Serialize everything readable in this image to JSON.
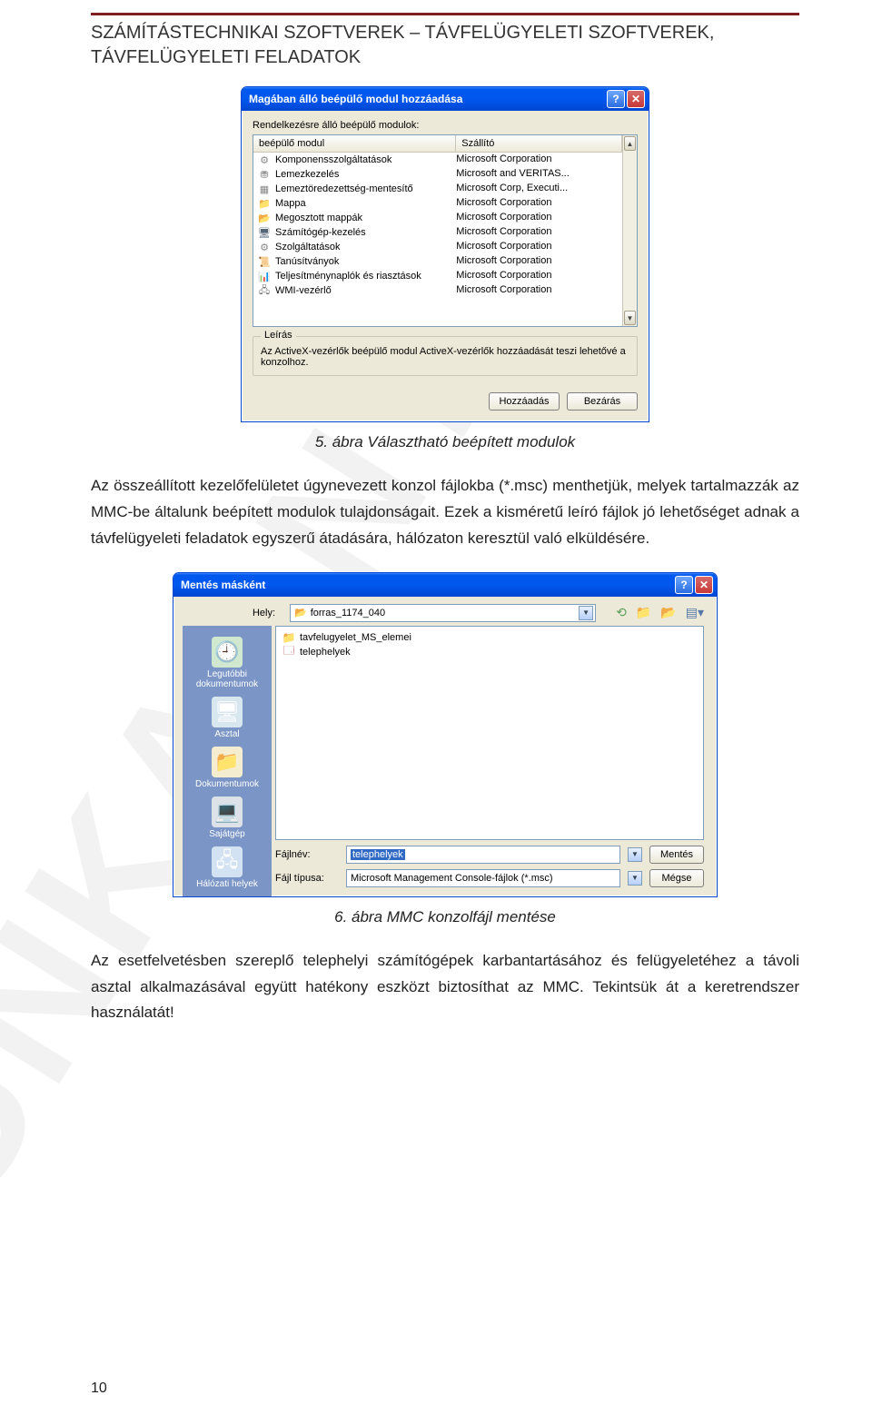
{
  "header": {
    "title": "SZÁMÍTÁSTECHNIKAI SZOFTVEREK – TÁVFELÜGYELETI SZOFTVEREK, TÁVFELÜGYELETI FELADATOK"
  },
  "watermark": "MUNKAANYAG",
  "dialog1": {
    "title": "Magában álló beépülő modul hozzáadása",
    "available_label": "Rendelkezésre álló beépülő modulok:",
    "col_module": "beépülő modul",
    "col_vendor": "Szállító",
    "rows": [
      {
        "name": "Komponensszolgáltatások",
        "vendor": "Microsoft Corporation"
      },
      {
        "name": "Lemezkezelés",
        "vendor": "Microsoft and VERITAS..."
      },
      {
        "name": "Lemeztöredezettség-mentesítő",
        "vendor": "Microsoft Corp, Executi..."
      },
      {
        "name": "Mappa",
        "vendor": "Microsoft Corporation"
      },
      {
        "name": "Megosztott mappák",
        "vendor": "Microsoft Corporation"
      },
      {
        "name": "Számítógép-kezelés",
        "vendor": "Microsoft Corporation"
      },
      {
        "name": "Szolgáltatások",
        "vendor": "Microsoft Corporation"
      },
      {
        "name": "Tanúsítványok",
        "vendor": "Microsoft Corporation"
      },
      {
        "name": "Teljesítménynaplók és riasztások",
        "vendor": "Microsoft Corporation"
      },
      {
        "name": "WMI-vezérlő",
        "vendor": "Microsoft Corporation"
      }
    ],
    "desc_legend": "Leírás",
    "desc_text": "Az ActiveX-vezérlők beépülő modul ActiveX-vezérlők hozzáadását teszi lehetővé a konzolhoz.",
    "btn_add": "Hozzáadás",
    "btn_close": "Bezárás"
  },
  "caption1": "5. ábra Választható beépített modulok",
  "para1": "Az összeállított kezelőfelületet úgynevezett konzol fájlokba (*.msc) menthetjük, melyek tartalmazzák az MMC-be általunk beépített modulok tulajdonságait. Ezek a kisméretű leíró fájlok jó lehetőséget adnak a távfelügyeleti feladatok egyszerű átadására, hálózaton keresztül való elküldésére.",
  "dialog2": {
    "title": "Mentés másként",
    "loc_label": "Hely:",
    "loc_value": "forras_1174_040",
    "places": [
      {
        "name": "Legutóbbi dokumentumok"
      },
      {
        "name": "Asztal"
      },
      {
        "name": "Dokumentumok"
      },
      {
        "name": "Sajátgép"
      },
      {
        "name": "Hálózati helyek"
      }
    ],
    "files": [
      {
        "name": "tavfelugyelet_MS_elemei"
      },
      {
        "name": "telephelyek"
      }
    ],
    "filename_label": "Fájlnév:",
    "filename_value": "telephelyek",
    "filetype_label": "Fájl típusa:",
    "filetype_value": "Microsoft Management Console-fájlok (*.msc)",
    "btn_save": "Mentés",
    "btn_cancel": "Mégse"
  },
  "caption2": "6. ábra MMC konzolfájl mentése",
  "para2": "Az esetfelvetésben szereplő telephelyi számítógépek karbantartásához és felügyeletéhez a távoli asztal alkalmazásával együtt hatékony eszközt biztosíthat az MMC. Tekintsük át a keretrendszer használatát!",
  "page_number": "10"
}
